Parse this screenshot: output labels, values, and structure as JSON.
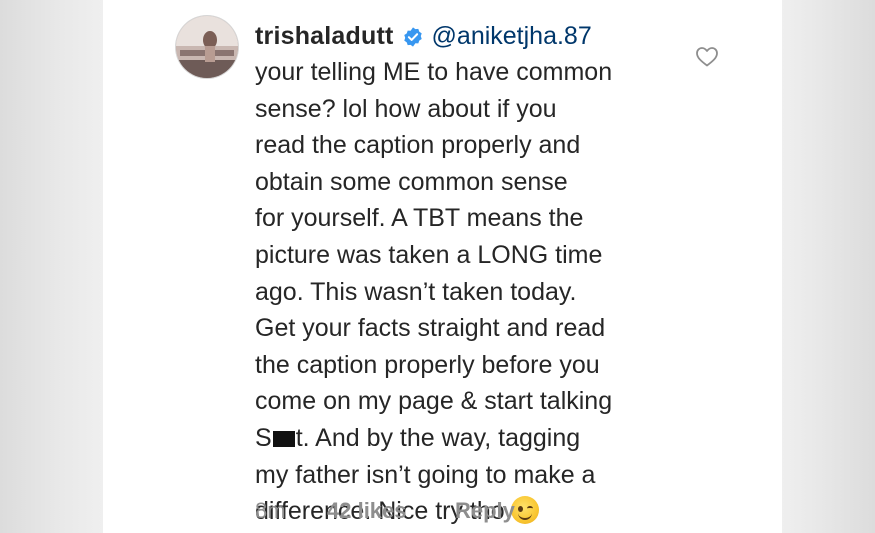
{
  "comment": {
    "username": "trishaladutt",
    "verified": true,
    "mention": "@aniketjha.87",
    "lines": [
      "your telling ME to have common",
      "sense? lol how about if you",
      "read the caption properly and",
      "obtain some common sense",
      "for yourself. A TBT means the",
      "picture was taken a LONG time",
      "ago. This wasn’t taken today.",
      "Get your facts straight and read",
      "the caption properly before you",
      "come on my page & start talking"
    ],
    "censored_line": {
      "before": "S",
      "after": "t. And by the way, tagging"
    },
    "lines_end": [
      "my father isn’t going to make a",
      "difference. Nice try tho"
    ]
  },
  "footer": {
    "time": "8m",
    "likes": "42 likes",
    "reply": "Reply"
  },
  "icons": {
    "verified": "verified-badge-icon",
    "heart": "heart-outline-icon",
    "emoji": "winking-face-emoji"
  },
  "colors": {
    "text": "#262626",
    "meta": "#8e8e8e",
    "verified": "#3897f0",
    "mention": "#00376b"
  }
}
